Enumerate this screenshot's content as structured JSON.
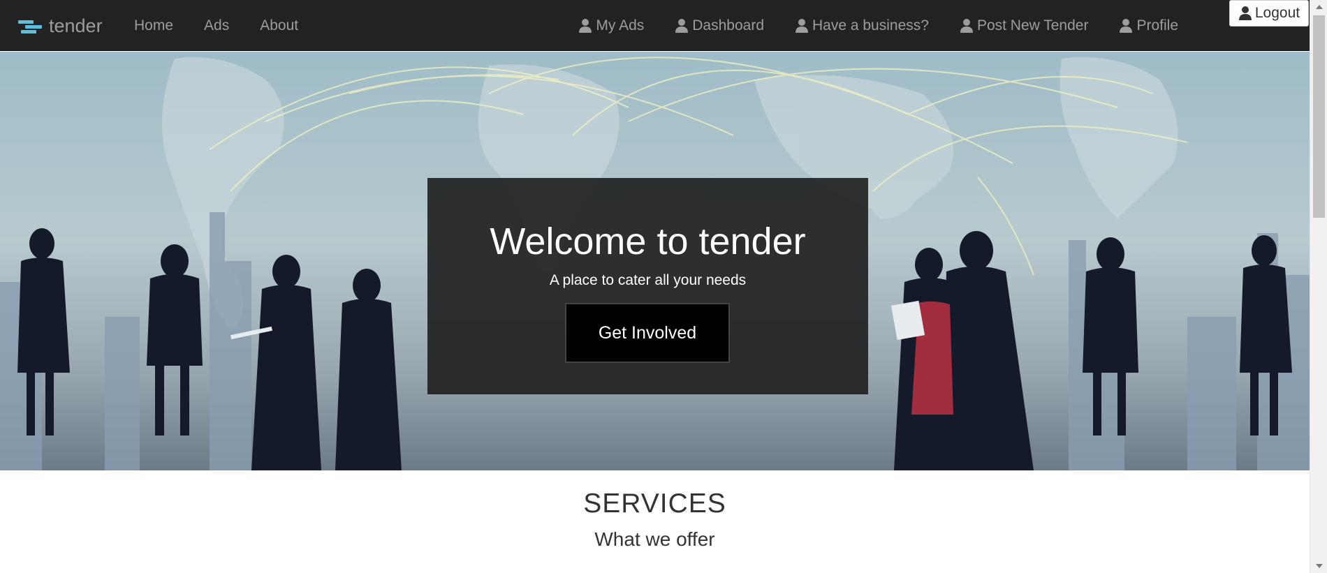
{
  "navbar": {
    "brand": "tender",
    "left_links": [
      "Home",
      "Ads",
      "About"
    ],
    "right_links": [
      "My Ads",
      "Dashboard",
      "Have a business?",
      "Post New Tender",
      "Profile"
    ],
    "logout_label": "Logout",
    "icon": "user-icon"
  },
  "hero": {
    "title": "Welcome to tender",
    "subtitle": "A place to cater all your needs",
    "cta_label": "Get Involved"
  },
  "services": {
    "title": "SERVICES",
    "subtitle": "What we offer"
  },
  "colors": {
    "navbar_bg": "#222222",
    "nav_text": "#9d9d9d",
    "brand_accent": "#5bc0de",
    "hero_box": "rgba(30,30,30,0.9)"
  }
}
